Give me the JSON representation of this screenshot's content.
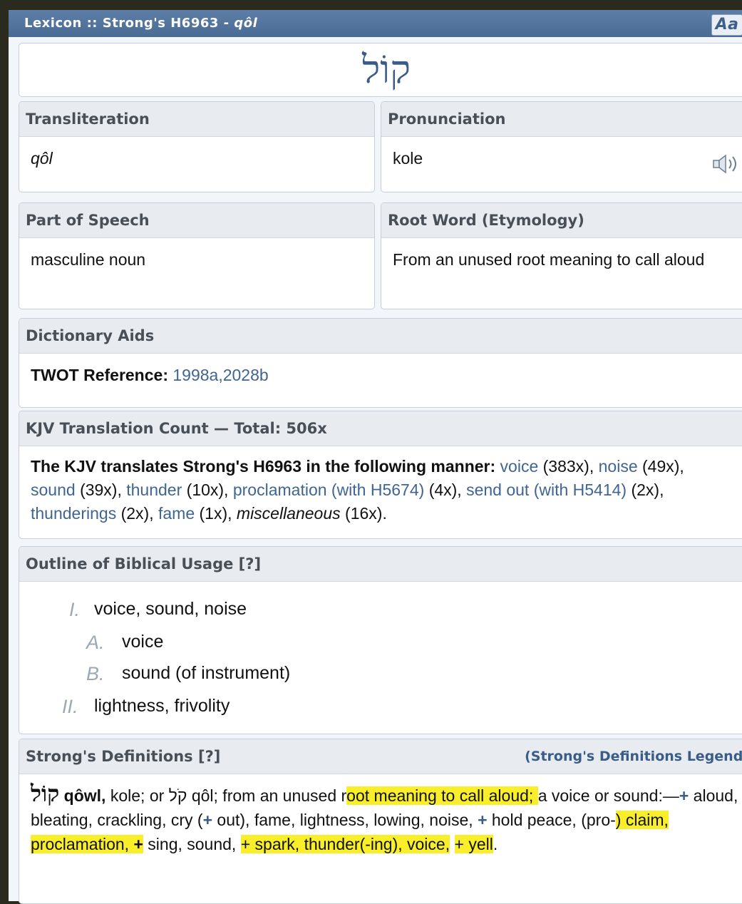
{
  "titlebar": {
    "prefix": "Lexicon :: Strong's H6963 - ",
    "word": "qôl",
    "font_button": "Aa"
  },
  "headword": "קוֹל",
  "transliteration": {
    "heading": "Transliteration",
    "value": "qôl"
  },
  "pronunciation": {
    "heading": "Pronunciation",
    "value": "kole",
    "icon": "speaker-icon"
  },
  "part_of_speech": {
    "heading": "Part of Speech",
    "value": "masculine noun"
  },
  "root_word": {
    "heading": "Root Word (Etymology)",
    "value": "From an unused root meaning to call aloud"
  },
  "dictionary_aids": {
    "heading": "Dictionary Aids",
    "label": "TWOT Reference:",
    "value": "1998a,2028b"
  },
  "kjv": {
    "heading": "KJV Translation Count — Total: 506x",
    "intro": "The KJV translates Strong's H6963 in the following manner:",
    "entries": [
      {
        "word": "voice",
        "count": "(383x),"
      },
      {
        "word": "noise",
        "count": "(49x),"
      },
      {
        "word": "sound",
        "count": "(39x),"
      },
      {
        "word": "thunder",
        "count": "(10x),"
      },
      {
        "word": "proclamation (with H5674)",
        "count": "(4x),"
      },
      {
        "word": "send out (with H5414)",
        "count": "(2x),"
      },
      {
        "word": "thunderings",
        "count": "(2x),"
      },
      {
        "word": "fame",
        "count": "(1x),"
      },
      {
        "word": "miscellaneous",
        "count": "(16x)."
      }
    ]
  },
  "outline": {
    "heading": "Outline of Biblical Usage [?]",
    "items": [
      {
        "num": "I.",
        "text": "voice, sound, noise"
      },
      {
        "num": "A.",
        "text": "voice"
      },
      {
        "num": "B.",
        "text": "sound (of instrument)"
      },
      {
        "num": "II.",
        "text": "lightness, frivolity"
      }
    ]
  },
  "strongs": {
    "heading": "Strong's Definitions [?]",
    "legend": "(Strong's Definitions Legend)",
    "hebrew": "קוֹל",
    "translit": "qôwl,",
    "t1": " kole; or ",
    "alt_hebrew": "קֹל",
    "t2": " qôl; from an unused r",
    "h1": "oot meaning to call aloud; ",
    "t3": "a voice or sound:—",
    "t4": "+",
    "t5": " aloud, bleating, crackling, cry (",
    "t6": "+",
    "t7": " out), fame, lightness, lowing, noise, ",
    "t8": "+",
    "t9": " hold peace, (pro-",
    "h2": ") claim, proclamation, ",
    "h2b": "+",
    "t10": " sing, sound, ",
    "h3": "+ spark, thunder(-ing), voice,",
    "h4": "+ yell",
    "t11": "."
  },
  "colors": {
    "highlight": "#f8ee2a",
    "link": "#3f6592",
    "titlebar": "#4a6b93"
  }
}
